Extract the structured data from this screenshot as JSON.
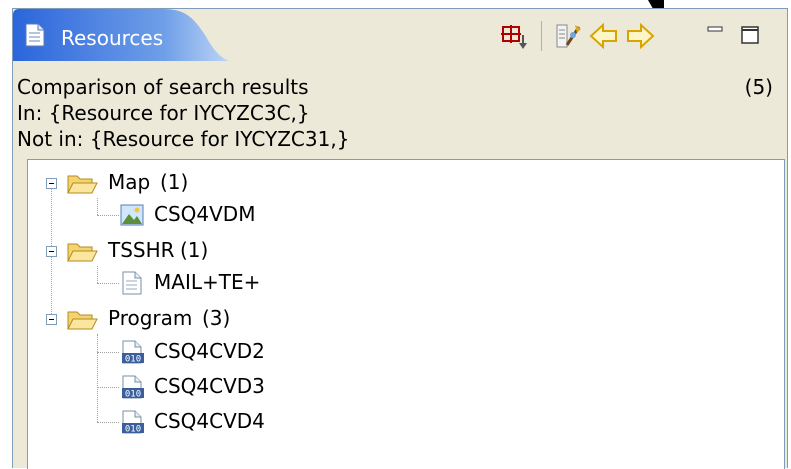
{
  "view": {
    "tab_title": "Resources",
    "icons": {
      "tab": "document-icon",
      "toolbar": [
        "grid-icon",
        "compare-icon",
        "back-arrow-icon",
        "forward-arrow-icon",
        "minimize-icon",
        "maximize-icon"
      ]
    }
  },
  "summary": {
    "heading": "Comparison of search results",
    "count": "(5)",
    "in_line": "In: {Resource for IYCYZC3C,}",
    "not_in_line": "Not in: {Resource for IYCYZC31,}"
  },
  "tree": {
    "groups": [
      {
        "label": "Map",
        "count": "(1)",
        "children": [
          {
            "label": "CSQ4VDM",
            "icon": "map-image-icon"
          }
        ]
      },
      {
        "label": "TSSHR",
        "count": "(1)",
        "children": [
          {
            "label": "MAIL+TE+",
            "icon": "text-document-icon"
          }
        ]
      },
      {
        "label": "Program",
        "count": "(3)",
        "children": [
          {
            "label": "CSQ4CVD2",
            "icon": "binary-program-icon"
          },
          {
            "label": "CSQ4CVD3",
            "icon": "binary-program-icon"
          },
          {
            "label": "CSQ4CVD4",
            "icon": "binary-program-icon"
          }
        ]
      }
    ]
  },
  "colors": {
    "tab_gradient_start": "#2f6ee0",
    "tab_gradient_end": "#9ec3f6",
    "folder": "#f2c94c",
    "arrow": "#f0c000",
    "frame_bg": "#ece9d8"
  }
}
